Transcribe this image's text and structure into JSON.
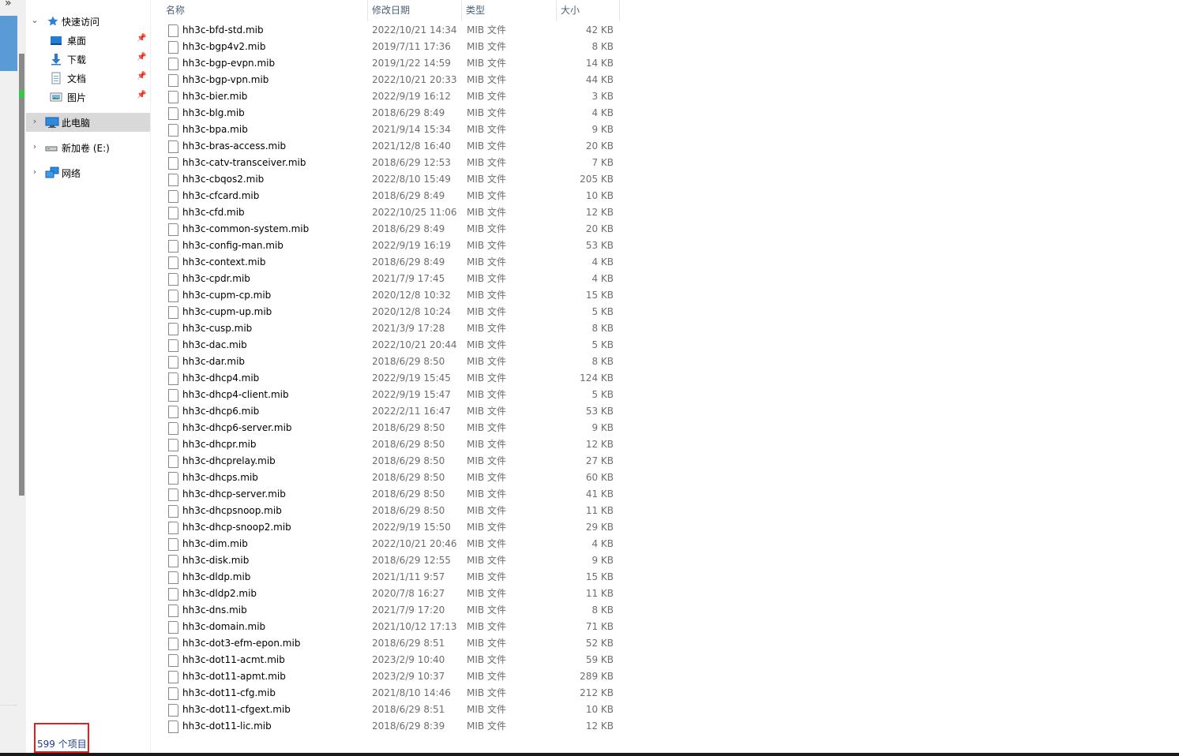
{
  "overflow_chevron": "»",
  "columns": {
    "name": "名称",
    "date": "修改日期",
    "type": "类型",
    "size": "大小"
  },
  "nav": {
    "quick_access": "快速访问",
    "desktop": "桌面",
    "downloads": "下载",
    "documents": "文档",
    "pictures": "图片",
    "this_pc": "此电脑",
    "new_volume": "新加卷 (E:)",
    "network": "网络"
  },
  "files": [
    {
      "name": "hh3c-bfd-std.mib",
      "date": "2022/10/21 14:34",
      "type": "MIB 文件",
      "size": "42 KB"
    },
    {
      "name": "hh3c-bgp4v2.mib",
      "date": "2019/7/11 17:36",
      "type": "MIB 文件",
      "size": "8 KB"
    },
    {
      "name": "hh3c-bgp-evpn.mib",
      "date": "2019/1/22 14:59",
      "type": "MIB 文件",
      "size": "14 KB"
    },
    {
      "name": "hh3c-bgp-vpn.mib",
      "date": "2022/10/21 20:33",
      "type": "MIB 文件",
      "size": "44 KB"
    },
    {
      "name": "hh3c-bier.mib",
      "date": "2022/9/19 16:12",
      "type": "MIB 文件",
      "size": "3 KB"
    },
    {
      "name": "hh3c-blg.mib",
      "date": "2018/6/29 8:49",
      "type": "MIB 文件",
      "size": "4 KB"
    },
    {
      "name": "hh3c-bpa.mib",
      "date": "2021/9/14 15:34",
      "type": "MIB 文件",
      "size": "9 KB"
    },
    {
      "name": "hh3c-bras-access.mib",
      "date": "2021/12/8 16:40",
      "type": "MIB 文件",
      "size": "20 KB"
    },
    {
      "name": "hh3c-catv-transceiver.mib",
      "date": "2018/6/29 12:53",
      "type": "MIB 文件",
      "size": "7 KB"
    },
    {
      "name": "hh3c-cbqos2.mib",
      "date": "2022/8/10 15:49",
      "type": "MIB 文件",
      "size": "205 KB"
    },
    {
      "name": "hh3c-cfcard.mib",
      "date": "2018/6/29 8:49",
      "type": "MIB 文件",
      "size": "10 KB"
    },
    {
      "name": "hh3c-cfd.mib",
      "date": "2022/10/25 11:06",
      "type": "MIB 文件",
      "size": "12 KB"
    },
    {
      "name": "hh3c-common-system.mib",
      "date": "2018/6/29 8:49",
      "type": "MIB 文件",
      "size": "20 KB"
    },
    {
      "name": "hh3c-config-man.mib",
      "date": "2022/9/19 16:19",
      "type": "MIB 文件",
      "size": "53 KB"
    },
    {
      "name": "hh3c-context.mib",
      "date": "2018/6/29 8:49",
      "type": "MIB 文件",
      "size": "4 KB"
    },
    {
      "name": "hh3c-cpdr.mib",
      "date": "2021/7/9 17:45",
      "type": "MIB 文件",
      "size": "4 KB"
    },
    {
      "name": "hh3c-cupm-cp.mib",
      "date": "2020/12/8 10:32",
      "type": "MIB 文件",
      "size": "15 KB"
    },
    {
      "name": "hh3c-cupm-up.mib",
      "date": "2020/12/8 10:24",
      "type": "MIB 文件",
      "size": "5 KB"
    },
    {
      "name": "hh3c-cusp.mib",
      "date": "2021/3/9 17:28",
      "type": "MIB 文件",
      "size": "8 KB"
    },
    {
      "name": "hh3c-dac.mib",
      "date": "2022/10/21 20:44",
      "type": "MIB 文件",
      "size": "5 KB"
    },
    {
      "name": "hh3c-dar.mib",
      "date": "2018/6/29 8:50",
      "type": "MIB 文件",
      "size": "8 KB"
    },
    {
      "name": "hh3c-dhcp4.mib",
      "date": "2022/9/19 15:45",
      "type": "MIB 文件",
      "size": "124 KB"
    },
    {
      "name": "hh3c-dhcp4-client.mib",
      "date": "2022/9/19 15:47",
      "type": "MIB 文件",
      "size": "5 KB"
    },
    {
      "name": "hh3c-dhcp6.mib",
      "date": "2022/2/11 16:47",
      "type": "MIB 文件",
      "size": "53 KB"
    },
    {
      "name": "hh3c-dhcp6-server.mib",
      "date": "2018/6/29 8:50",
      "type": "MIB 文件",
      "size": "9 KB"
    },
    {
      "name": "hh3c-dhcpr.mib",
      "date": "2018/6/29 8:50",
      "type": "MIB 文件",
      "size": "12 KB"
    },
    {
      "name": "hh3c-dhcprelay.mib",
      "date": "2018/6/29 8:50",
      "type": "MIB 文件",
      "size": "27 KB"
    },
    {
      "name": "hh3c-dhcps.mib",
      "date": "2018/6/29 8:50",
      "type": "MIB 文件",
      "size": "60 KB"
    },
    {
      "name": "hh3c-dhcp-server.mib",
      "date": "2018/6/29 8:50",
      "type": "MIB 文件",
      "size": "41 KB"
    },
    {
      "name": "hh3c-dhcpsnoop.mib",
      "date": "2018/6/29 8:50",
      "type": "MIB 文件",
      "size": "11 KB"
    },
    {
      "name": "hh3c-dhcp-snoop2.mib",
      "date": "2022/9/19 15:50",
      "type": "MIB 文件",
      "size": "29 KB"
    },
    {
      "name": "hh3c-dim.mib",
      "date": "2022/10/21 20:46",
      "type": "MIB 文件",
      "size": "4 KB"
    },
    {
      "name": "hh3c-disk.mib",
      "date": "2018/6/29 12:55",
      "type": "MIB 文件",
      "size": "9 KB"
    },
    {
      "name": "hh3c-dldp.mib",
      "date": "2021/1/11 9:57",
      "type": "MIB 文件",
      "size": "15 KB"
    },
    {
      "name": "hh3c-dldp2.mib",
      "date": "2020/7/8 16:27",
      "type": "MIB 文件",
      "size": "11 KB"
    },
    {
      "name": "hh3c-dns.mib",
      "date": "2021/7/9 17:20",
      "type": "MIB 文件",
      "size": "8 KB"
    },
    {
      "name": "hh3c-domain.mib",
      "date": "2021/10/12 17:13",
      "type": "MIB 文件",
      "size": "71 KB"
    },
    {
      "name": "hh3c-dot3-efm-epon.mib",
      "date": "2018/6/29 8:51",
      "type": "MIB 文件",
      "size": "52 KB"
    },
    {
      "name": "hh3c-dot11-acmt.mib",
      "date": "2023/2/9 10:40",
      "type": "MIB 文件",
      "size": "59 KB"
    },
    {
      "name": "hh3c-dot11-apmt.mib",
      "date": "2023/2/9 10:37",
      "type": "MIB 文件",
      "size": "289 KB"
    },
    {
      "name": "hh3c-dot11-cfg.mib",
      "date": "2021/8/10 14:46",
      "type": "MIB 文件",
      "size": "212 KB"
    },
    {
      "name": "hh3c-dot11-cfgext.mib",
      "date": "2018/6/29 8:51",
      "type": "MIB 文件",
      "size": "10 KB"
    },
    {
      "name": "hh3c-dot11-lic.mib",
      "date": "2018/6/29 8:39",
      "type": "MIB 文件",
      "size": "12 KB"
    }
  ],
  "status": {
    "item_count": "599 个项目"
  },
  "colors": {
    "highlight_box": "#e02020",
    "selected_nav": "#d9d9d9",
    "header_text": "#4c607a"
  }
}
